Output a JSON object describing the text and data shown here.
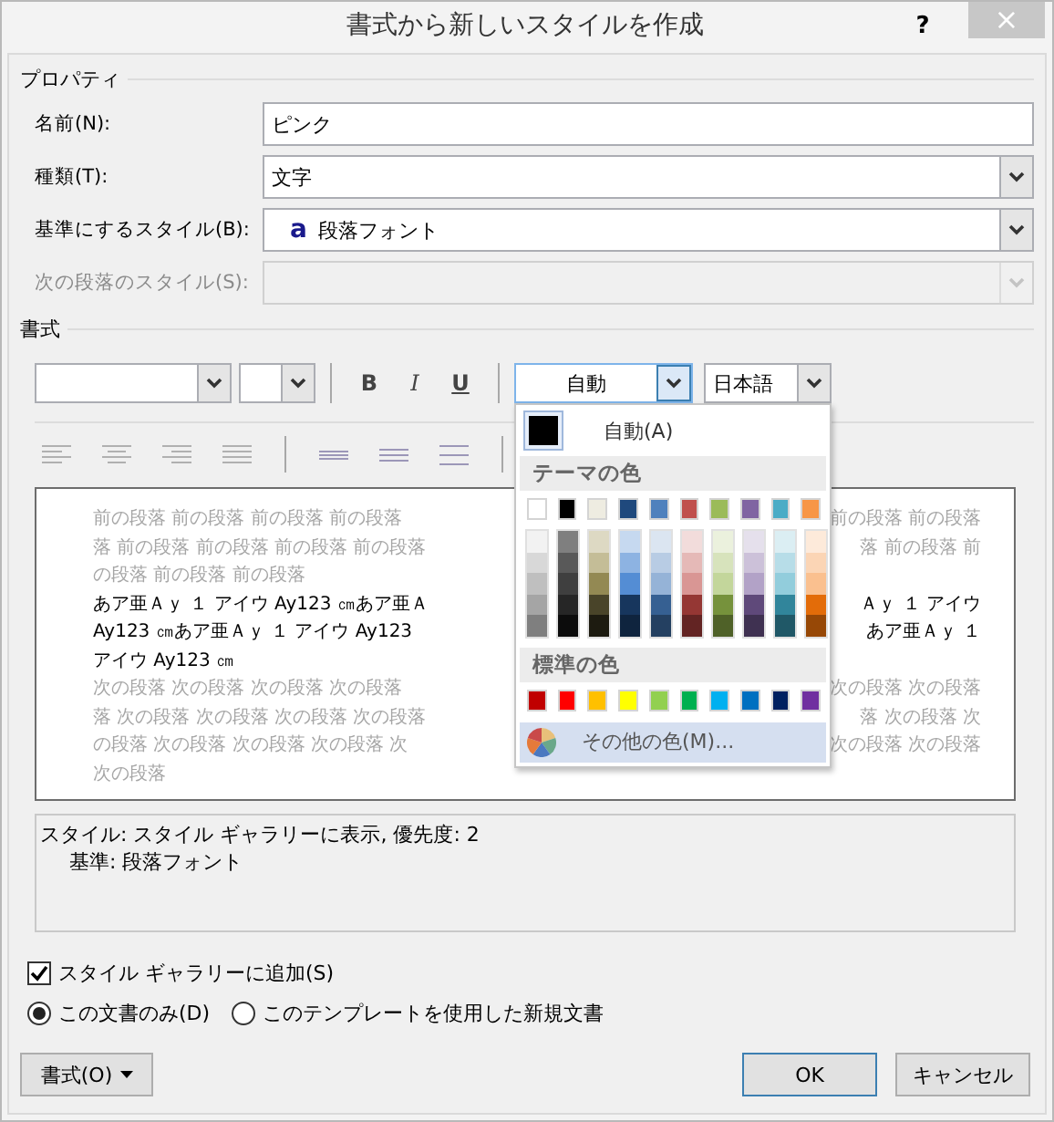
{
  "window": {
    "title": "書式から新しいスタイルを作成",
    "help": "?",
    "close": "×"
  },
  "properties": {
    "heading": "プロパティ",
    "fields": [
      {
        "label": "名前(N):",
        "kind": "text",
        "value": "ピンク",
        "disabled": false
      },
      {
        "label": "種類(T):",
        "kind": "combo",
        "value": "文字",
        "disabled": false
      },
      {
        "label": "基準にするスタイル(B):",
        "kind": "combo",
        "glyph": "a",
        "value": "段落フォント",
        "disabled": false
      },
      {
        "label": "次の段落のスタイル(S):",
        "kind": "combo",
        "disabled": true
      }
    ]
  },
  "formatting": {
    "heading": "書式",
    "toolbar": [
      {
        "kind": "font-combo"
      },
      {
        "kind": "size-combo"
      },
      {
        "kind": "separator"
      },
      {
        "kind": "bold",
        "label": "B",
        "on": false
      },
      {
        "kind": "italic",
        "label": "I",
        "on": false
      },
      {
        "kind": "underline",
        "label": "U",
        "on": false
      },
      {
        "kind": "separator"
      },
      {
        "kind": "color-combo",
        "value": "自動",
        "open": true
      },
      {
        "kind": "language-combo",
        "value": "日本語"
      }
    ],
    "paragraph_tools": {
      "disabled": true
    }
  },
  "color_popup": {
    "auto": {
      "label": "自動(A)",
      "color": "#000000",
      "selected": true
    },
    "theme_heading": "テーマの色",
    "theme_colors": [
      {
        "color": "#ffffff",
        "shades": [
          {
            "color": "#f2f2f2"
          },
          {
            "color": "#d8d8d8"
          },
          {
            "color": "#bfbfbf"
          },
          {
            "color": "#a5a5a5"
          },
          {
            "color": "#7f7f7f"
          }
        ]
      },
      {
        "color": "#000000",
        "shades": [
          {
            "color": "#7f7f7f"
          },
          {
            "color": "#595959"
          },
          {
            "color": "#3f3f3f"
          },
          {
            "color": "#262626"
          },
          {
            "color": "#0c0c0c"
          }
        ]
      },
      {
        "color": "#eeece1",
        "shades": [
          {
            "color": "#ddd9c3"
          },
          {
            "color": "#c4bd97"
          },
          {
            "color": "#938953"
          },
          {
            "color": "#494429"
          },
          {
            "color": "#1d1b10"
          }
        ]
      },
      {
        "color": "#1f497d",
        "shades": [
          {
            "color": "#c6d9f0"
          },
          {
            "color": "#8db3e2"
          },
          {
            "color": "#548dd4"
          },
          {
            "color": "#17365d"
          },
          {
            "color": "#0f243e"
          }
        ]
      },
      {
        "color": "#4f81bd",
        "shades": [
          {
            "color": "#dbe5f1"
          },
          {
            "color": "#b8cce4"
          },
          {
            "color": "#95b3d7"
          },
          {
            "color": "#366092"
          },
          {
            "color": "#244061"
          }
        ]
      },
      {
        "color": "#c0504d",
        "shades": [
          {
            "color": "#f2dcdb"
          },
          {
            "color": "#e5b9b7"
          },
          {
            "color": "#d99694"
          },
          {
            "color": "#953734"
          },
          {
            "color": "#632423"
          }
        ]
      },
      {
        "color": "#9bbb59",
        "shades": [
          {
            "color": "#ebf1dd"
          },
          {
            "color": "#d7e3bc"
          },
          {
            "color": "#c3d69b"
          },
          {
            "color": "#76923c"
          },
          {
            "color": "#4f6128"
          }
        ]
      },
      {
        "color": "#8064a2",
        "shades": [
          {
            "color": "#e5e0ec"
          },
          {
            "color": "#ccc1d9"
          },
          {
            "color": "#b2a2c7"
          },
          {
            "color": "#5f497a"
          },
          {
            "color": "#3f3151"
          }
        ]
      },
      {
        "color": "#4bacc6",
        "shades": [
          {
            "color": "#dbeef3"
          },
          {
            "color": "#b7dde8"
          },
          {
            "color": "#92cddc"
          },
          {
            "color": "#31859b"
          },
          {
            "color": "#205867"
          }
        ]
      },
      {
        "color": "#f79646",
        "shades": [
          {
            "color": "#fdeada"
          },
          {
            "color": "#fbd5b5"
          },
          {
            "color": "#fac08f"
          },
          {
            "color": "#e36c09"
          },
          {
            "color": "#974806"
          }
        ]
      }
    ],
    "standard_heading": "標準の色",
    "standard_colors": [
      {
        "color": "#c00000"
      },
      {
        "color": "#ff0000"
      },
      {
        "color": "#ffc000"
      },
      {
        "color": "#ffff00"
      },
      {
        "color": "#92d050"
      },
      {
        "color": "#00b050"
      },
      {
        "color": "#00b0f0"
      },
      {
        "color": "#0070c0"
      },
      {
        "color": "#002060"
      },
      {
        "color": "#7030a0"
      }
    ],
    "more": {
      "label": "その他の色(M)...",
      "highlighted": true
    }
  },
  "preview": {
    "lines": [
      {
        "kind": "before",
        "left": "前の段落 前の段落 前の段落 前の段落",
        "right": "前の段落 前の段落"
      },
      {
        "kind": "before",
        "left": "落 前の段落 前の段落 前の段落 前の段落",
        "right": "落 前の段落 前"
      },
      {
        "kind": "before",
        "left": "の段落 前の段落 前の段落"
      },
      {
        "kind": "sample",
        "left": "あア亜Ａｙ １ アイウ Ay123 ㎝あア亜Ａ",
        "right": "Ａｙ １ アイウ"
      },
      {
        "kind": "sample",
        "left": "Ay123 ㎝あア亜Ａｙ １ アイウ Ay123",
        "right": "あア亜Ａｙ １"
      },
      {
        "kind": "sample",
        "left": "アイウ Ay123 ㎝"
      },
      {
        "kind": "after",
        "left": "次の段落 次の段落 次の段落 次の段落",
        "right": "次の段落 次の段落"
      },
      {
        "kind": "after",
        "left": "落 次の段落 次の段落 次の段落 次の段落",
        "right": "落 次の段落 次"
      },
      {
        "kind": "after",
        "left": "の段落 次の段落 次の段落 次の段落 次",
        "right": "次の段落 次の段落"
      },
      {
        "kind": "after",
        "left": "次の段落"
      }
    ]
  },
  "description": [
    {
      "text": "スタイル: スタイル ギャラリーに表示, 優先度: 2",
      "indented": false
    },
    {
      "text": "基準: 段落フォント",
      "indented": true
    }
  ],
  "gallery_checkbox": {
    "label": "スタイル ギャラリーに追加(S)",
    "checked": true
  },
  "scope": [
    {
      "label": "この文書のみ(D)",
      "selected": true
    },
    {
      "label": "このテンプレートを使用した新規文書",
      "selected": false
    }
  ],
  "buttons": [
    {
      "label": "書式(O)",
      "kind": "menu"
    },
    {
      "label": "OK",
      "kind": "default"
    },
    {
      "label": "キャンセル",
      "kind": "normal"
    }
  ]
}
